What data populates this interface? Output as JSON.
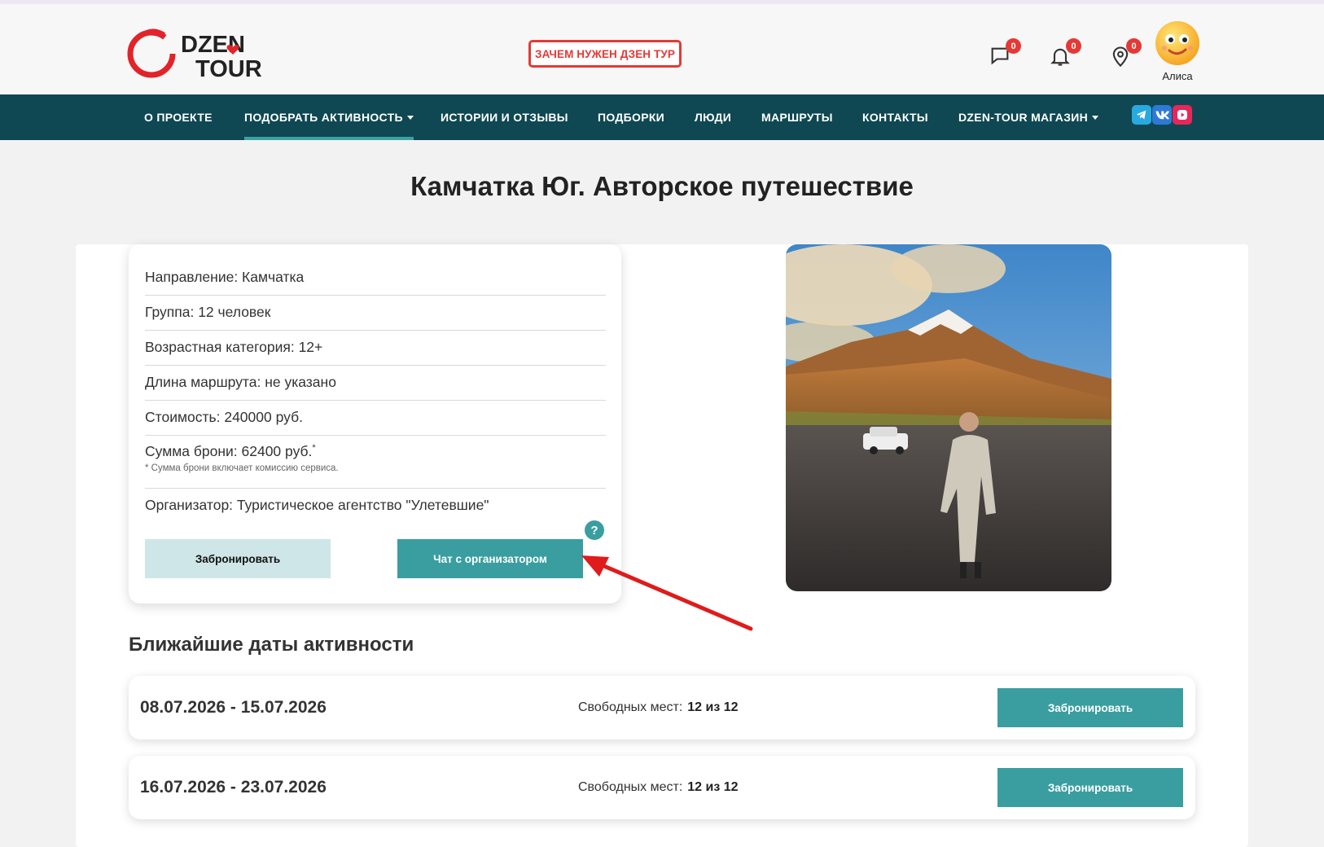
{
  "header": {
    "logo_text_1": "DZEN",
    "logo_text_2": "TOUR",
    "why_button": "ЗАЧЕМ НУЖЕН ДЗЕН ТУР",
    "messages_count": "0",
    "notifications_count": "0",
    "places_count": "0",
    "user_name": "Алиса"
  },
  "nav": {
    "items": [
      "О ПРОЕКТЕ",
      "ПОДОБРАТЬ АКТИВНОСТЬ",
      "ИСТОРИИ И ОТЗЫВЫ",
      "ПОДБОРКИ",
      "ЛЮДИ",
      "МАРШРУТЫ",
      "КОНТАКТЫ",
      "DZEN-TOUR МАГАЗИН"
    ],
    "active": "ПОДОБРАТЬ АКТИВНОСТЬ",
    "socials": [
      "telegram-icon",
      "vk-icon",
      "rutube-icon"
    ]
  },
  "page": {
    "title": "Камчатка Юг. Авторское путешествие"
  },
  "info": {
    "direction": "Направление: Камчатка",
    "group": "Группа: 12 человек",
    "age": "Возрастная категория: 12+",
    "length": "Длина маршрута: не указано",
    "price": "Стоимость: 240000 руб.",
    "deposit": "Сумма брони: 62400 руб.",
    "deposit_mark": "*",
    "deposit_note": "* Сумма брони включает комиссию сервиса.",
    "organizer": "Организатор: Туристическое агентство \"Улетевшие\"",
    "book_button": "Забронировать",
    "chat_button": "Чат с организатором",
    "help": "?"
  },
  "dates": {
    "title": "Ближайшие даты активности",
    "seats_label": "Свободных мест:",
    "book_button": "Забронировать",
    "items": [
      {
        "range": "08.07.2026 - 15.07.2026",
        "seats": "12 из 12"
      },
      {
        "range": "16.07.2026 - 23.07.2026",
        "seats": "12 из 12"
      }
    ]
  },
  "colors": {
    "nav_bg": "#0f4852",
    "accent": "#3a9ea0",
    "badge": "#e53935"
  }
}
